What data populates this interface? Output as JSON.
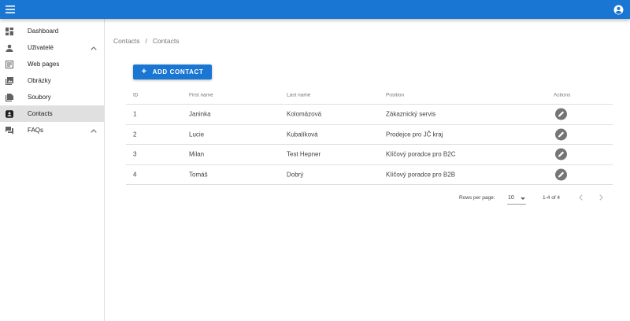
{
  "appbar": {
    "color": "#1976d2",
    "menu_icon": "hamburger-menu-icon",
    "account_icon": "account-circle-icon"
  },
  "sidebar": {
    "items": [
      {
        "label": "Dashboard",
        "icon": "dashboard-icon"
      },
      {
        "label": "Uživatelé",
        "icon": "person-icon",
        "expandable": true
      },
      {
        "label": "Web pages",
        "icon": "web-page-icon"
      },
      {
        "label": "Obrázky",
        "icon": "image-library-icon"
      },
      {
        "label": "Soubory",
        "icon": "file-library-icon"
      },
      {
        "label": "Contacts",
        "icon": "contacts-icon",
        "active": true
      },
      {
        "label": "FAQs",
        "icon": "forum-icon",
        "expandable": true
      }
    ]
  },
  "breadcrumb": {
    "items": [
      "Contacts",
      "Contacts"
    ],
    "separator": "/"
  },
  "toolbar": {
    "add_label": "ADD CONTACT"
  },
  "table": {
    "columns": [
      "ID",
      "First name",
      "Last name",
      "Position",
      "Actions"
    ],
    "rows": [
      {
        "id": "1",
        "first": "Janinka",
        "last": "Kolomázová",
        "position": "Zákaznický servis"
      },
      {
        "id": "2",
        "first": "Lucie",
        "last": "Kubalíková",
        "position": "Prodejce pro JČ kraj"
      },
      {
        "id": "3",
        "first": "Milan",
        "last": "Test Hepner",
        "position": "Klíčový poradce pro B2C"
      },
      {
        "id": "4",
        "first": "Tomáš",
        "last": "Dobrý",
        "position": "Klíčový poradce pro B2B"
      }
    ]
  },
  "pagination": {
    "rows_per_page_label": "Rows per page:",
    "rows_per_page": "10",
    "range": "1-4 of 4"
  }
}
